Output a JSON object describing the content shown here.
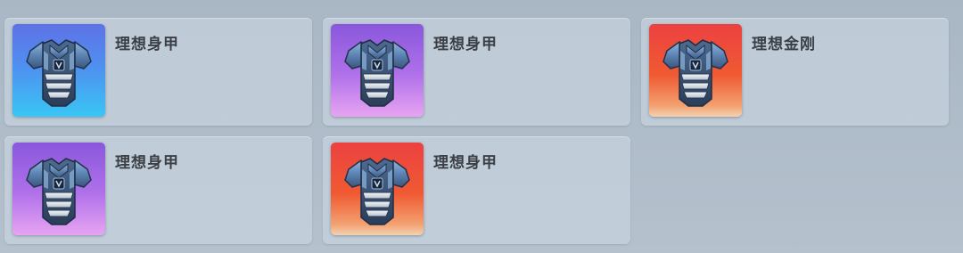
{
  "items": [
    {
      "name": "理想身甲",
      "rarity_color": "blue",
      "icon": "armor-vest-icon"
    },
    {
      "name": "理想身甲",
      "rarity_color": "purple",
      "icon": "armor-vest-icon"
    },
    {
      "name": "理想金刚",
      "rarity_color": "red",
      "icon": "armor-vest-icon"
    },
    {
      "name": "理想身甲",
      "rarity_color": "purple",
      "icon": "armor-vest-icon"
    },
    {
      "name": "理想身甲",
      "rarity_color": "red",
      "icon": "armor-vest-icon"
    }
  ],
  "colors": {
    "blue": "#4f8ff0",
    "purple": "#b071ea",
    "red": "#f05a32",
    "card_text": "#3b3f45"
  }
}
